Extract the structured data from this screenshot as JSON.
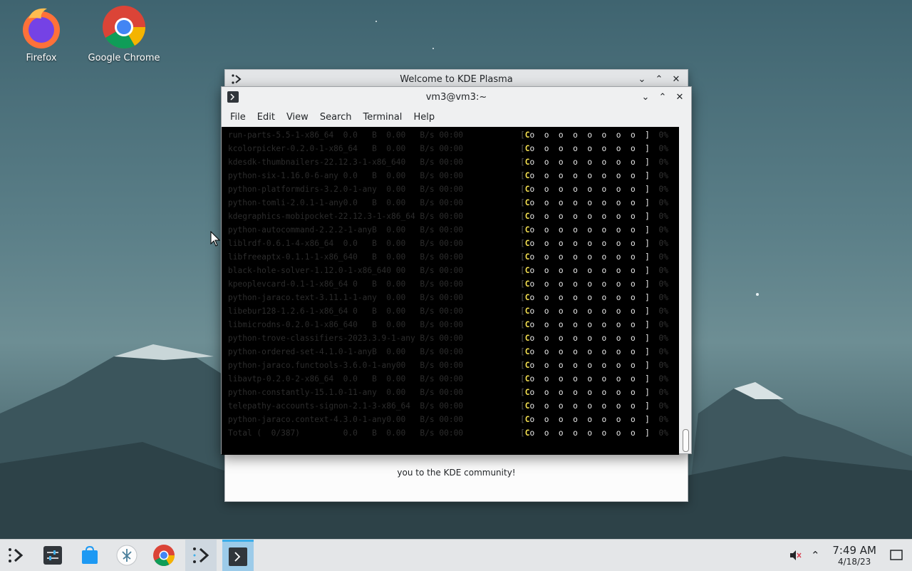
{
  "desktop": {
    "icons": [
      {
        "label": "Firefox",
        "icon": "firefox-icon"
      },
      {
        "label": "Google Chrome",
        "icon": "chrome-icon"
      }
    ]
  },
  "welcome_window": {
    "title": "Welcome to KDE Plasma",
    "body_text": "you to the KDE community!"
  },
  "konsole": {
    "title": "vm3@vm3:~",
    "menu": [
      "File",
      "Edit",
      "View",
      "Search",
      "Terminal",
      "Help"
    ],
    "lines": [
      {
        "pkg": "run-parts-5.5-1-x86_64  0.0   B  0.00   B/s 00:00 ",
        "pct": "0%"
      },
      {
        "pkg": "kcolorpicker-0.2.0-1-x86_64   B  0.00   B/s 00:00 ",
        "pct": "0%"
      },
      {
        "pkg": "kdesdk-thumbnailers-22.12.3-1-x86_640   B/s 00:00 ",
        "pct": "0%"
      },
      {
        "pkg": "python-six-1.16.0-6-any 0.0   B  0.00   B/s 00:00 ",
        "pct": "0%"
      },
      {
        "pkg": "python-platformdirs-3.2.0-1-any  0.00   B/s 00:00 ",
        "pct": "0%"
      },
      {
        "pkg": "python-tomli-2.0.1-1-any0.0   B  0.00   B/s 00:00 ",
        "pct": "0%"
      },
      {
        "pkg": "kdegraphics-mobipocket-22.12.3-1-x86_64 B/s 00:00 ",
        "pct": "0%"
      },
      {
        "pkg": "python-autocommand-2.2.2-1-anyB  0.00   B/s 00:00 ",
        "pct": "0%"
      },
      {
        "pkg": "liblrdf-0.6.1-4-x86_64  0.0   B  0.00   B/s 00:00 ",
        "pct": "0%"
      },
      {
        "pkg": "libfreeaptx-0.1.1-1-x86_640   B  0.00   B/s 00:00 ",
        "pct": "0%"
      },
      {
        "pkg": "black-hole-solver-1.12.0-1-x86_640 00   B/s 00:00 ",
        "pct": "0%"
      },
      {
        "pkg": "kpeoplevcard-0.1-1-x86_64 0   B  0.00   B/s 00:00 ",
        "pct": "0%"
      },
      {
        "pkg": "python-jaraco.text-3.11.1-1-any  0.00   B/s 00:00 ",
        "pct": "0%"
      },
      {
        "pkg": "libebur128-1.2.6-1-x86_64 0   B  0.00   B/s 00:00 ",
        "pct": "0%"
      },
      {
        "pkg": "libmicrodns-0.2.0-1-x86_640   B  0.00   B/s 00:00 ",
        "pct": "0%"
      },
      {
        "pkg": "python-trove-classifiers-2023.3.9-1-any B/s 00:00 ",
        "pct": "0%"
      },
      {
        "pkg": "python-ordered-set-4.1.0-1-anyB  0.00   B/s 00:00 ",
        "pct": "0%"
      },
      {
        "pkg": "python-jaraco.functools-3.6.0-1-any00   B/s 00:00 ",
        "pct": "0%"
      },
      {
        "pkg": "libavtp-0.2.0-2-x86_64  0.0   B  0.00   B/s 00:00 ",
        "pct": "0%"
      },
      {
        "pkg": "python-constantly-15.1.0-11-any  0.00   B/s 00:00 ",
        "pct": "0%"
      },
      {
        "pkg": "telepathy-accounts-signon-2.1-3-x86_64  B/s 00:00 ",
        "pct": "0%"
      },
      {
        "pkg": "python-jaraco.context-4.3.0-1-any0.00   B/s 00:00 ",
        "pct": "0%"
      },
      {
        "pkg": "Total (  0/387)         0.0   B  0.00   B/s 00:00 ",
        "pct": "0%"
      }
    ],
    "pacman_bar": "[Co  o  o  o  o  o  o  o  ]"
  },
  "taskbar": {
    "apps": [
      "app-launcher-icon",
      "system-settings-icon",
      "discover-icon",
      "kde-connect-icon",
      "chrome-icon",
      "welcome-icon",
      "konsole-icon"
    ],
    "clock": {
      "time": "7:49 AM",
      "date": "4/18/23"
    }
  }
}
